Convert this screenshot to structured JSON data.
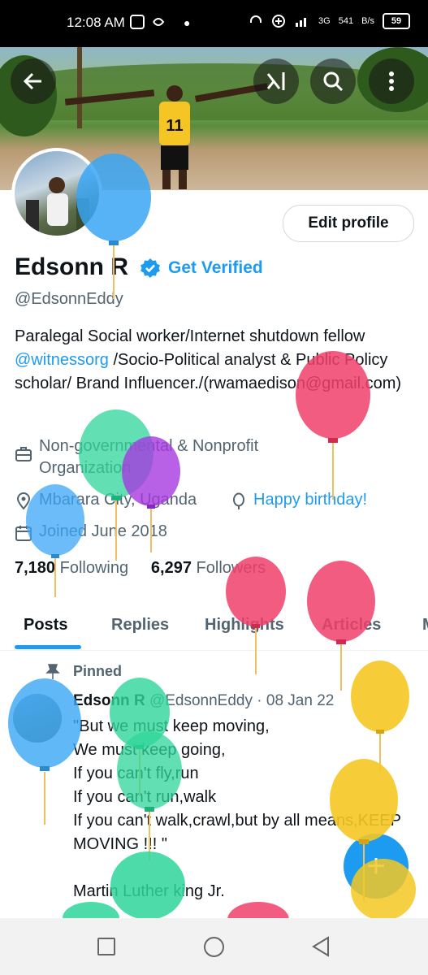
{
  "status_bar": {
    "time": "12:08 AM",
    "network": "3G",
    "speed_value": "541",
    "speed_unit": "B/s",
    "battery": "59"
  },
  "profile": {
    "name": "Edsonn R",
    "get_verified": "Get Verified",
    "handle": "@EdsonnEddy",
    "edit_button": "Edit profile",
    "bio_before_link": "Paralegal Social worker/Internet shutdown fellow ",
    "bio_link": "@witnessorg",
    "bio_after_link": " /Socio-Political analyst & Public Policy scholar/ Brand Influencer./(rwamaedison@gmail.com)",
    "category": "Non-governmental & Nonprofit Organization",
    "location": "Mbarara City, Uganda",
    "birthday": "Happy birthday!",
    "joined": "Joined June 2018",
    "following_count": "7,180",
    "following_label": "Following",
    "followers_count": "6,297",
    "followers_label": "Followers"
  },
  "tabs": [
    "Posts",
    "Replies",
    "Highlights",
    "Articles",
    "M"
  ],
  "pinned_tweet": {
    "pinned_label": "Pinned",
    "author": "Edsonn R",
    "handle_date": "@EdsonnEddy · 08 Jan 22",
    "text": "\"But we must keep moving,\nWe must keep going,\nIf you can't fly,run\nIf you can't run,walk\nIf you can't walk,crawl,but by all means,KEEP MOVING !!! \"\n\nMartin Luther king Jr."
  },
  "colors": {
    "accent": "#1d9bf0",
    "text": "#0f1419",
    "muted": "#536471"
  },
  "icons": [
    "arrow-back-icon",
    "grok-icon",
    "search-icon",
    "more-icon",
    "verified-badge-icon",
    "briefcase-icon",
    "location-icon",
    "balloon-icon",
    "calendar-icon",
    "pin-icon",
    "compose-icon",
    "nav-recents-icon",
    "nav-home-icon",
    "nav-back-icon"
  ]
}
